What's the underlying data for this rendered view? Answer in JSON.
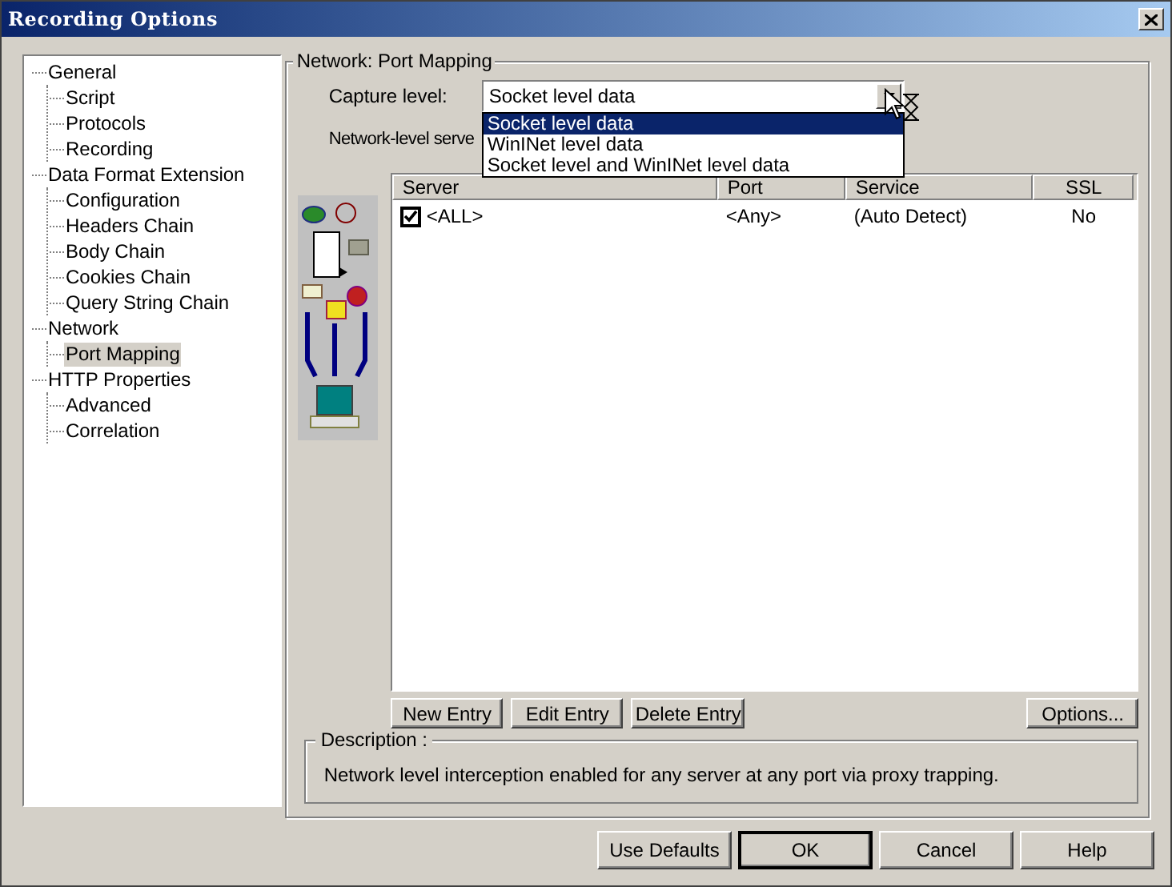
{
  "window": {
    "title": "Recording Options"
  },
  "tree": [
    {
      "label": "General",
      "selected": false,
      "children": [
        {
          "label": "Script",
          "selected": false
        },
        {
          "label": "Protocols",
          "selected": false
        },
        {
          "label": "Recording",
          "selected": false
        }
      ]
    },
    {
      "label": "Data Format Extension",
      "selected": false,
      "children": [
        {
          "label": "Configuration",
          "selected": false
        },
        {
          "label": "Headers Chain",
          "selected": false
        },
        {
          "label": "Body Chain",
          "selected": false
        },
        {
          "label": "Cookies Chain",
          "selected": false
        },
        {
          "label": "Query String Chain",
          "selected": false
        }
      ]
    },
    {
      "label": "Network",
      "selected": false,
      "children": [
        {
          "label": "Port Mapping",
          "selected": true
        }
      ]
    },
    {
      "label": "HTTP Properties",
      "selected": false,
      "children": [
        {
          "label": "Advanced",
          "selected": false
        },
        {
          "label": "Correlation",
          "selected": false
        }
      ]
    }
  ],
  "section_title": "Network: Port Mapping",
  "capture_level": {
    "label": "Capture level:",
    "value": "Socket level data",
    "expanded": true,
    "options": [
      {
        "label": "Socket level data",
        "selected": true
      },
      {
        "label": "WinINet level data",
        "selected": false
      },
      {
        "label": "Socket level and WinINet level data",
        "selected": false
      }
    ]
  },
  "network_level_label": "Network-level serve",
  "table": {
    "columns": [
      "Server",
      "Port",
      "Service",
      "SSL"
    ],
    "rows": [
      {
        "checked": true,
        "cells": [
          "<ALL>",
          "<Any>",
          "(Auto Detect)",
          "No"
        ]
      }
    ]
  },
  "table_buttons": [
    "New Entry",
    "Edit Entry",
    "Delete Entry"
  ],
  "options_button": "Options...",
  "description": {
    "title": "Description :",
    "text": "Network level interception enabled for any server at any port via proxy trapping."
  },
  "dialog_buttons": [
    {
      "label": "Use Defaults",
      "default": false
    },
    {
      "label": "OK",
      "default": true
    },
    {
      "label": "Cancel",
      "default": false
    },
    {
      "label": "Help",
      "default": false
    }
  ]
}
